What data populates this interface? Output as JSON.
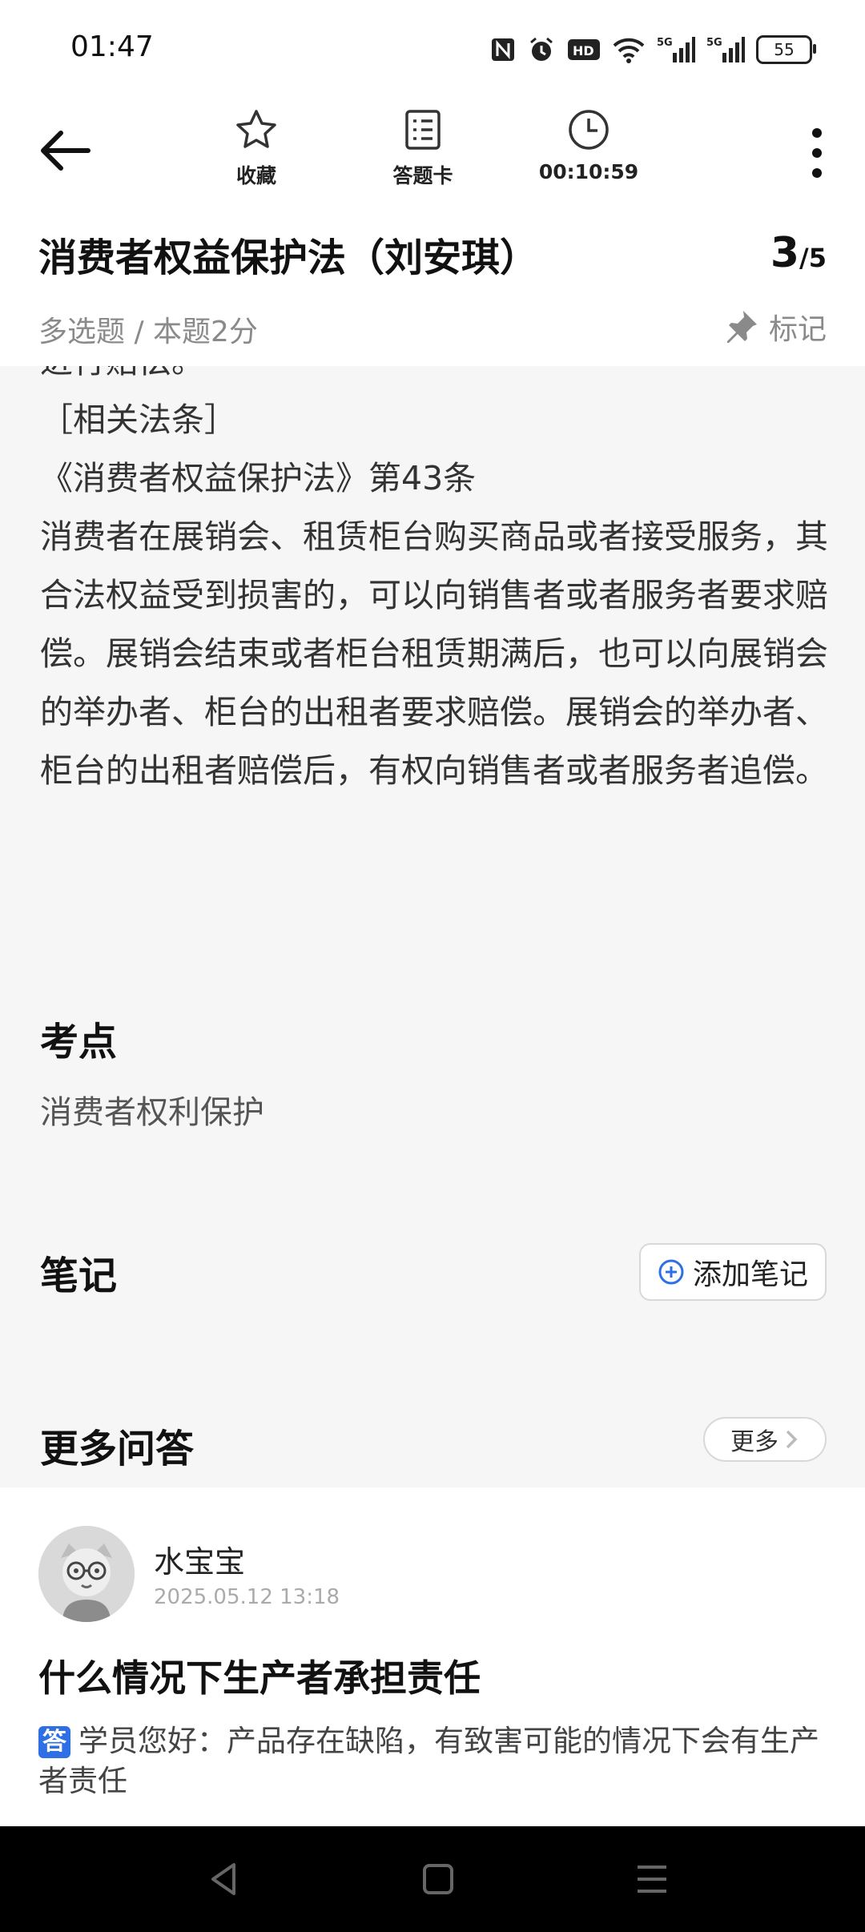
{
  "status_bar": {
    "time": "01:47",
    "icons": [
      "nfc-icon",
      "alarm-icon",
      "hd-icon",
      "wifi-icon",
      "signal-5g-icon",
      "signal-5g-icon"
    ],
    "network_label": "5G",
    "hd_label": "HD",
    "battery": "55"
  },
  "toolbar": {
    "favorite_label": "收藏",
    "answer_card_label": "答题卡",
    "timer": "00:10:59"
  },
  "question": {
    "title": "消费者权益保护法（刘安琪）",
    "current": "3",
    "total": "/5",
    "meta": "多选题 / 本题2分",
    "mark_label": "标记"
  },
  "analysis": {
    "paragraphs": [
      "进行赔偿。",
      "［相关法条］",
      "《消费者权益保护法》第43条",
      "消费者在展销会、租赁柜台购买商品或者接受服务，其合法权益受到损害的，可以向销售者或者服务者要求赔偿。展销会结束或者柜台租赁期满后，也可以向展销会的举办者、柜台的出租者要求赔偿。展销会的举办者、柜台的出租者赔偿后，有权向销售者或者服务者追偿。"
    ]
  },
  "sections": {
    "exam_point_title": "考点",
    "exam_point_text": "消费者权利保护",
    "notes_title": "笔记",
    "add_note_label": "添加笔记",
    "more_qa_title": "更多问答",
    "more_label": "更多"
  },
  "qa": {
    "user_name": "水宝宝",
    "time": "2025.05.12  13:18",
    "question": "什么情况下生产者承担责任",
    "answer_badge": "答",
    "answer": "学员您好：产品存在缺陷，有致害可能的情况下会有生产者责任"
  },
  "colors": {
    "accent": "#2f6fe6",
    "content_bg": "#f6f6f6",
    "muted": "#8a8a8a"
  }
}
